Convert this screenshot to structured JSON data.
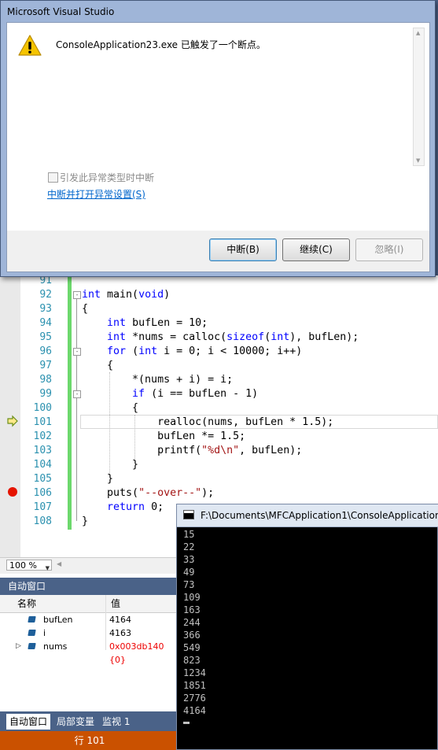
{
  "dialog": {
    "title": "Microsoft Visual Studio",
    "message": "ConsoleApplication23.exe 已触发了一个断点。",
    "checkbox_label": "引发此异常类型时中断",
    "link": "中断并打开异常设置(S)",
    "buttons": {
      "break": "中断(B)",
      "continue": "继续(C)",
      "ignore": "忽略(I)"
    }
  },
  "editor": {
    "line_numbers": [
      "91",
      "92",
      "93",
      "94",
      "95",
      "96",
      "97",
      "98",
      "99",
      "100",
      "101",
      "102",
      "103",
      "104",
      "105",
      "106",
      "107",
      "108"
    ],
    "lines": [
      "",
      "int main(void)",
      "{",
      "    int bufLen = 10;",
      "    int *nums = calloc(sizeof(int), bufLen);",
      "    for (int i = 0; i < 10000; i++)",
      "    {",
      "        *(nums + i) = i;",
      "        if (i == bufLen - 1)",
      "        {",
      "            realloc(nums, bufLen * 1.5);",
      "            bufLen *= 1.5;",
      "            printf(\"%d\\n\", bufLen);",
      "        }",
      "    }",
      "    puts(\"--over--\");",
      "    return 0;",
      "}"
    ],
    "zoom": "100 %"
  },
  "autos": {
    "title": "自动窗口",
    "columns": {
      "name": "名称",
      "value": "值"
    },
    "rows": [
      {
        "name": "bufLen",
        "value": "4164"
      },
      {
        "name": "i",
        "value": "4163"
      },
      {
        "name": "nums",
        "value": "0x003db140 {0}"
      }
    ],
    "tabs": [
      "自动窗口",
      "局部变量",
      "监视 1"
    ]
  },
  "statusbar": {
    "line": "行 101"
  },
  "console": {
    "title": "F:\\Documents\\MFCApplication1\\ConsoleApplication",
    "output": [
      "15",
      "22",
      "33",
      "49",
      "73",
      "109",
      "163",
      "244",
      "366",
      "549",
      "823",
      "1234",
      "1851",
      "2776",
      "4164"
    ]
  },
  "colors": {
    "breakpoint": "#e51400",
    "status_bar": "#ca5100",
    "panel_title": "#4a6288",
    "line_numbers": "#2b91af"
  }
}
